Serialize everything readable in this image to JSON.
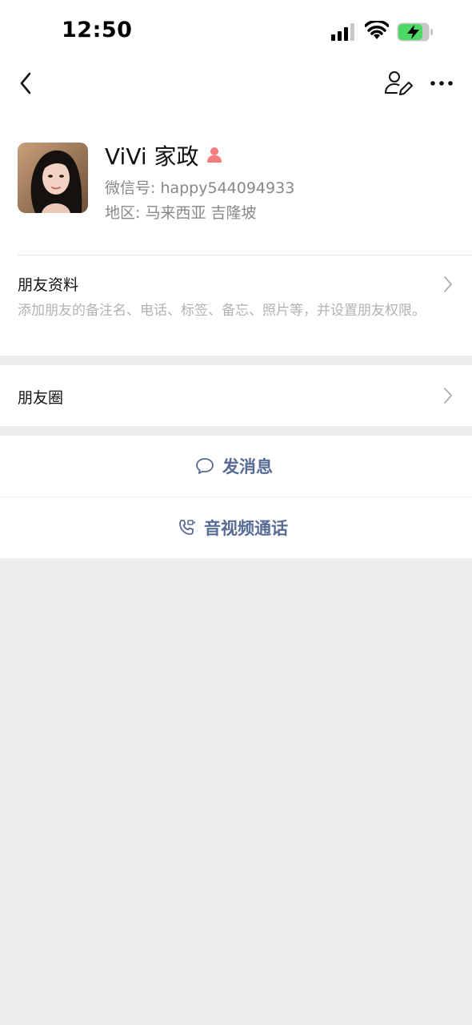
{
  "status_bar": {
    "time": "12:50"
  },
  "profile": {
    "name": "ViVi 家政",
    "wechat_id": "微信号: happy544094933",
    "region": "地区: 马来西亚 吉隆坡"
  },
  "friend_info": {
    "title": "朋友资料",
    "description": "添加朋友的备注名、电话、标签、备忘、照片等，并设置朋友权限。"
  },
  "moments": {
    "title": "朋友圈"
  },
  "actions": {
    "send_message": "发消息",
    "voice_video_call": "音视频通话"
  },
  "colors": {
    "link": "#576b95",
    "background": "#ededed",
    "gender_female": "#f37e7d",
    "battery_green": "#4cd964"
  }
}
